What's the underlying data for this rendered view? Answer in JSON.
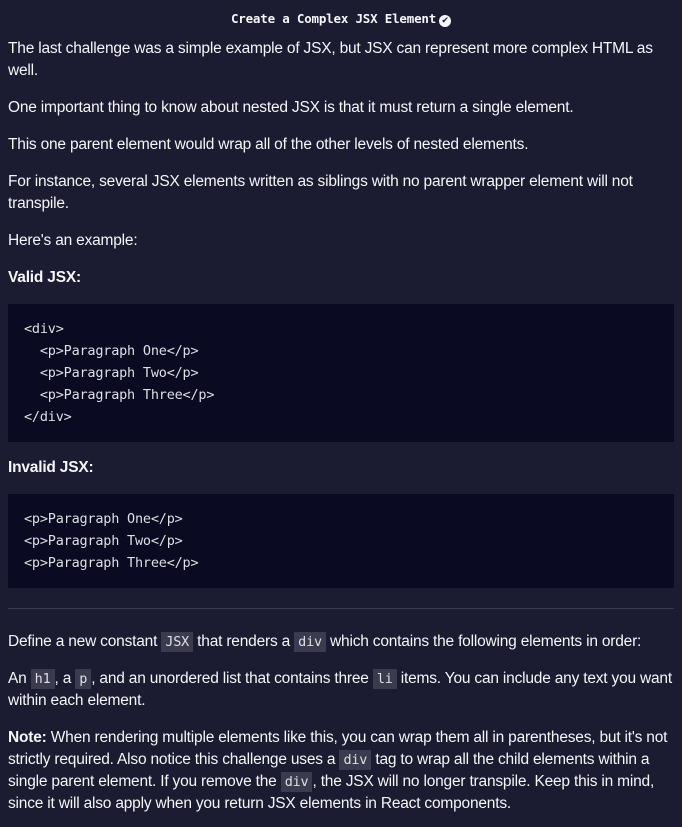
{
  "title": "Create a Complex JSX Element",
  "p1": "The last challenge was a simple example of JSX, but JSX can represent more complex HTML as well.",
  "p2": "One important thing to know about nested JSX is that it must return a single element.",
  "p3": "This one parent element would wrap all of the other levels of nested elements.",
  "p4": "For instance, several JSX elements written as siblings with no parent wrapper element will not transpile.",
  "p5": "Here's an example:",
  "valid_label": "Valid JSX:",
  "valid_code": "<div>\n  <p>Paragraph One</p>\n  <p>Paragraph Two</p>\n  <p>Paragraph Three</p>\n</div>",
  "invalid_label": "Invalid JSX:",
  "invalid_code": "<p>Paragraph One</p>\n<p>Paragraph Two</p>\n<p>Paragraph Three</p>",
  "task1": {
    "a": "Define a new constant ",
    "c1": "JSX",
    "b": " that renders a ",
    "c2": "div",
    "d": " which contains the following elements in order:"
  },
  "task2": {
    "a": "An ",
    "c1": "h1",
    "b": ", a ",
    "c2": "p",
    "d": ", and an unordered list that contains three ",
    "c3": "li",
    "e": " items. You can include any text you want within each element."
  },
  "note": {
    "label": "Note:",
    "a": " When rendering multiple elements like this, you can wrap them all in parentheses, but it's not strictly required. Also notice this challenge uses a ",
    "c1": "div",
    "b": " tag to wrap all the child elements within a single parent element. If you remove the ",
    "c2": "div",
    "d": ", the JSX will no longer transpile. Keep this in mind, since it will also apply when you return JSX elements in React components."
  }
}
